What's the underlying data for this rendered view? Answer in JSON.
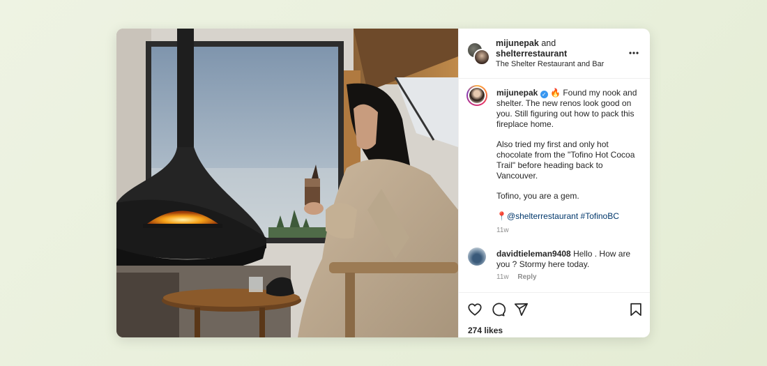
{
  "post": {
    "header": {
      "user1": "mijunepak",
      "and": "and",
      "user2": "shelterrestaurant",
      "location": "The Shelter Restaurant and Bar",
      "more_icon": "more-horizontal-icon"
    },
    "caption": {
      "username": "mijunepak",
      "verified_icon": "verified-badge-icon",
      "line1": "🔥 Found my nook and shelter. The new renos look good on you. Still figuring out how to pack this fireplace home.",
      "line2": "Also tried my first and only hot chocolate from the \"Tofino Hot Cocoa Trail\" before heading back to Vancouver.",
      "line3": "Tofino, you are a gem.",
      "pin": "📍",
      "mention": "@shelterrestaurant",
      "hashtag": "#TofinoBC",
      "time": "11w"
    },
    "comment": {
      "username": "davidtieleman9408",
      "text": "Hello . How are you ? Stormy here today.",
      "time": "11w",
      "reply_label": "Reply"
    },
    "actions": {
      "like_icon": "heart-icon",
      "comment_icon": "comment-icon",
      "share_icon": "send-icon",
      "save_icon": "bookmark-icon"
    },
    "likes": "274 likes"
  },
  "colors": {
    "link": "#00376b",
    "verified": "#3897f0",
    "meta": "#8e8e8e",
    "text": "#262626"
  }
}
